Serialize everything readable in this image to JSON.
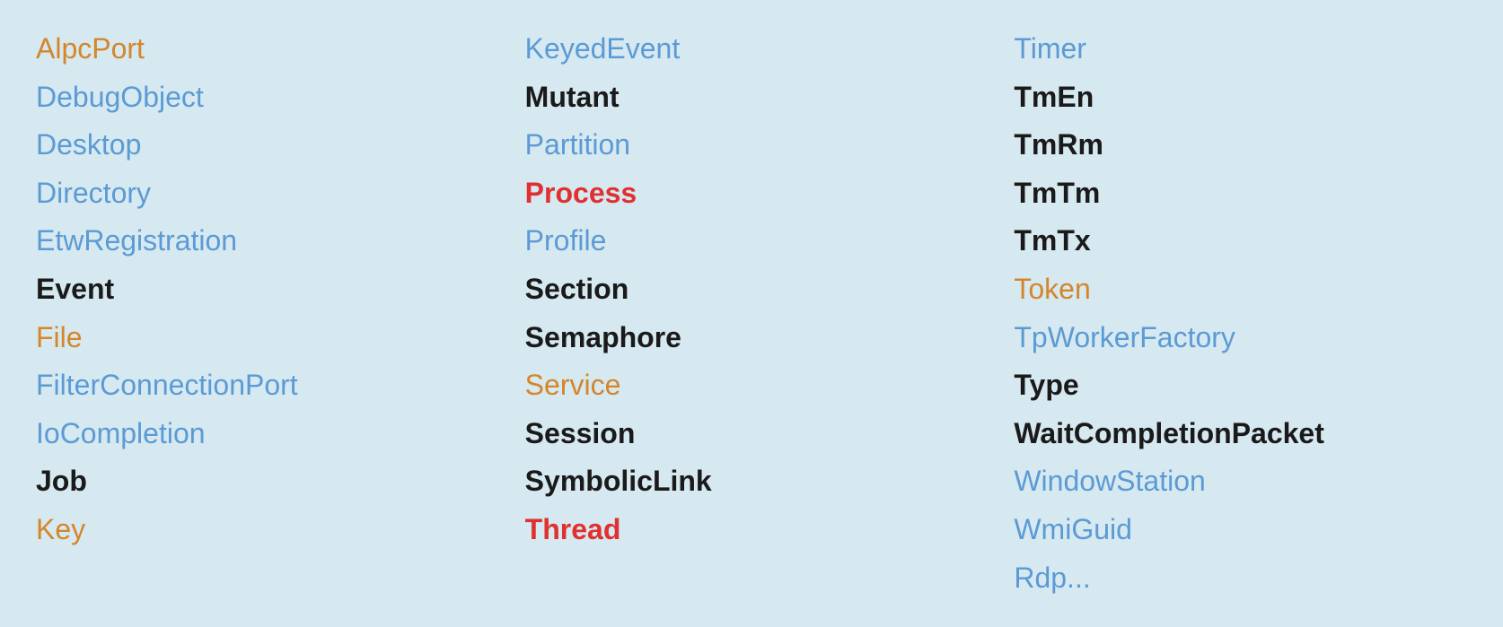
{
  "columns": [
    {
      "id": "col1",
      "items": [
        {
          "label": "AlpcPort",
          "color": "orange"
        },
        {
          "label": "DebugObject",
          "color": "blue"
        },
        {
          "label": "Desktop",
          "color": "blue"
        },
        {
          "label": "Directory",
          "color": "blue"
        },
        {
          "label": "EtwRegistration",
          "color": "blue"
        },
        {
          "label": "Event",
          "color": "black"
        },
        {
          "label": "File",
          "color": "orange"
        },
        {
          "label": "FilterConnectionPort",
          "color": "blue"
        },
        {
          "label": "IoCompletion",
          "color": "blue"
        },
        {
          "label": "Job",
          "color": "black"
        },
        {
          "label": "Key",
          "color": "orange"
        }
      ]
    },
    {
      "id": "col2",
      "items": [
        {
          "label": "KeyedEvent",
          "color": "blue"
        },
        {
          "label": "Mutant",
          "color": "black"
        },
        {
          "label": "Partition",
          "color": "blue"
        },
        {
          "label": "Process",
          "color": "red"
        },
        {
          "label": "Profile",
          "color": "blue"
        },
        {
          "label": "Section",
          "color": "black"
        },
        {
          "label": "Semaphore",
          "color": "black"
        },
        {
          "label": "Service",
          "color": "orange"
        },
        {
          "label": "Session",
          "color": "black"
        },
        {
          "label": "SymbolicLink",
          "color": "black"
        },
        {
          "label": "Thread",
          "color": "red"
        }
      ]
    },
    {
      "id": "col3",
      "items": [
        {
          "label": "Timer",
          "color": "blue"
        },
        {
          "label": "TmEn",
          "color": "black"
        },
        {
          "label": "TmRm",
          "color": "black"
        },
        {
          "label": "TmTm",
          "color": "black"
        },
        {
          "label": "TmTx",
          "color": "black"
        },
        {
          "label": "Token",
          "color": "orange"
        },
        {
          "label": "TpWorkerFactory",
          "color": "blue"
        },
        {
          "label": "Type",
          "color": "black"
        },
        {
          "label": "WaitCompletionPacket",
          "color": "black"
        },
        {
          "label": "WindowStation",
          "color": "blue"
        },
        {
          "label": "WmiGuid",
          "color": "blue"
        },
        {
          "label": "Rdp...",
          "color": "blue"
        }
      ]
    }
  ]
}
